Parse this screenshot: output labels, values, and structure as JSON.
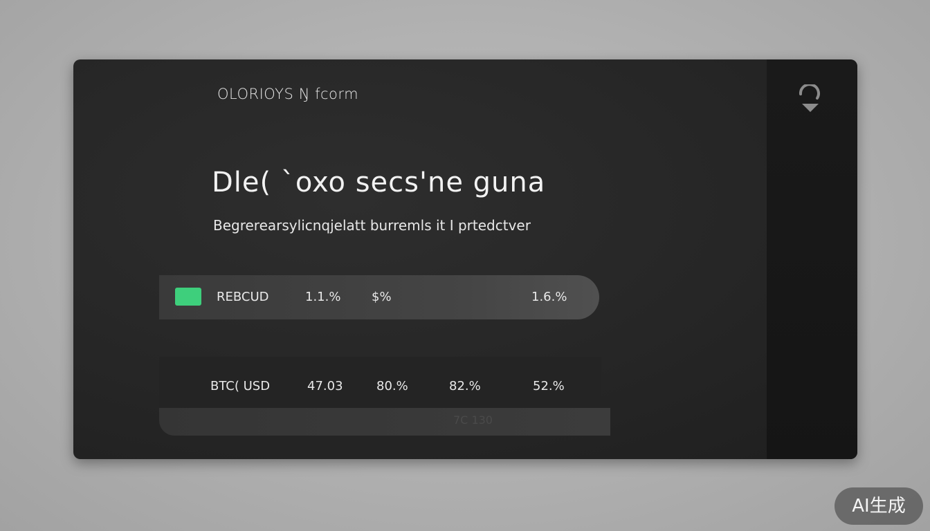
{
  "header": {
    "brand": "OLORIOYS Ŋ fcorm",
    "close_icon": "return-icon"
  },
  "hero": {
    "headline": "Dle( `oxo secs'ne guna",
    "subtitle": "Begrerearsylicnqjelatt burremls it  I prtedctver"
  },
  "table": {
    "rows": [
      {
        "pair": "REBCUD",
        "col1": "1.1.%",
        "col2": "$%",
        "col3": "",
        "col4": "1.6.%",
        "badge_color": "#3ecf7c"
      },
      {
        "pair": "BTC( USD",
        "col1": "47.03",
        "col2": "80.%",
        "col3": "82.%",
        "col4": "52.%"
      }
    ],
    "footer_text": "7C 130"
  },
  "watermark": {
    "label": "AI生成"
  },
  "colors": {
    "accent": "#3ecf7c",
    "card_bg": "#262626",
    "page_bg": "#b3b3b3"
  }
}
